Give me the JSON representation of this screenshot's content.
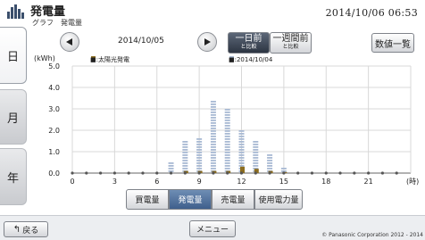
{
  "header": {
    "title": "発電量",
    "subtitle": "グラフ　発電量",
    "datetime": "2014/10/06  06:53"
  },
  "side_tabs": {
    "day": "日",
    "month": "月",
    "year": "年"
  },
  "nav": {
    "date": "2014/10/05",
    "cmp_day_main": "一日前",
    "cmp_day_sub": "と比較",
    "cmp_week_main": "一週間前",
    "cmp_week_sub": "と比較",
    "list_label": "数値一覧"
  },
  "chart_data": {
    "type": "bar",
    "ylabel": "(kWh)",
    "xlabel": "(時)",
    "ylim": [
      0,
      5
    ],
    "yticks": [
      "5.0",
      "4.0",
      "3.0",
      "2.0",
      "1.0",
      "0.0"
    ],
    "xticks": [
      "0",
      "3",
      "6",
      "9",
      "12",
      "15",
      "18",
      "21"
    ],
    "legend": {
      "current": "■:太陽光発電",
      "compare": "■:2014/10/04"
    },
    "x": [
      0,
      1,
      2,
      3,
      4,
      5,
      6,
      7,
      8,
      9,
      10,
      11,
      12,
      13,
      14,
      15,
      16,
      17,
      18,
      19,
      20,
      21,
      22,
      23
    ],
    "series": [
      {
        "name": "太陽光発電",
        "values": [
          0,
          0,
          0,
          0,
          0,
          0,
          0,
          0,
          0.1,
          0.1,
          0.1,
          0.1,
          0.3,
          0.2,
          0.1,
          0.05,
          0,
          0,
          0,
          0,
          0,
          0,
          0,
          0
        ]
      },
      {
        "name": "2014/10/04",
        "values": [
          0,
          0,
          0,
          0,
          0,
          0,
          0,
          0.5,
          1.6,
          1.7,
          3.4,
          3.1,
          2.1,
          1.6,
          0.9,
          0.3,
          0,
          0,
          0,
          0,
          0,
          0,
          0,
          0
        ]
      }
    ],
    "colors": {
      "current": "#8c6d1f",
      "compare": "#a8b9d3",
      "grid": "#d8d8d8"
    },
    "grid": true,
    "legend_position": "top"
  },
  "type_buttons": {
    "buy": "買電量",
    "gen": "発電量",
    "sell": "売電量",
    "use": "使用電力量"
  },
  "footer": {
    "back": "戻る",
    "menu": "メニュー",
    "copyright": "© Panasonic Corporation 2012 - 2014"
  }
}
